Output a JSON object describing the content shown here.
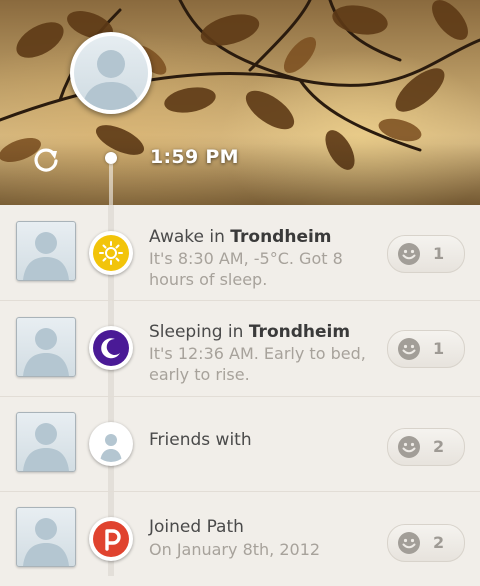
{
  "header": {
    "time": "1:59 PM"
  },
  "feed": [
    {
      "type": "awake",
      "title_prefix": "Awake in",
      "title_bold": "Trondheim",
      "subtitle": "It's 8:30 AM, -5°C. Got 8 hours of sleep.",
      "smile_count": "1",
      "icon": "sun-icon",
      "icon_color": "#f2c40a"
    },
    {
      "type": "sleeping",
      "title_prefix": "Sleeping in",
      "title_bold": "Trondheim",
      "subtitle": "It's 12:36 AM. Early to bed, early to rise.",
      "smile_count": "1",
      "icon": "moon-icon",
      "icon_color": "#4a1a96"
    },
    {
      "type": "friends",
      "title_prefix": "Friends with",
      "title_bold": "",
      "subtitle": "",
      "smile_count": "2",
      "icon": "person-icon",
      "icon_color": "#ffffff"
    },
    {
      "type": "joined",
      "title_prefix": "Joined Path",
      "title_bold": "",
      "subtitle": "On January 8th, 2012",
      "smile_count": "2",
      "icon": "path-logo-icon",
      "icon_color": "#e0432f"
    }
  ],
  "colors": {
    "background": "#f1eee9",
    "text_primary": "#4a4a4a",
    "text_secondary": "#a7a29b"
  }
}
